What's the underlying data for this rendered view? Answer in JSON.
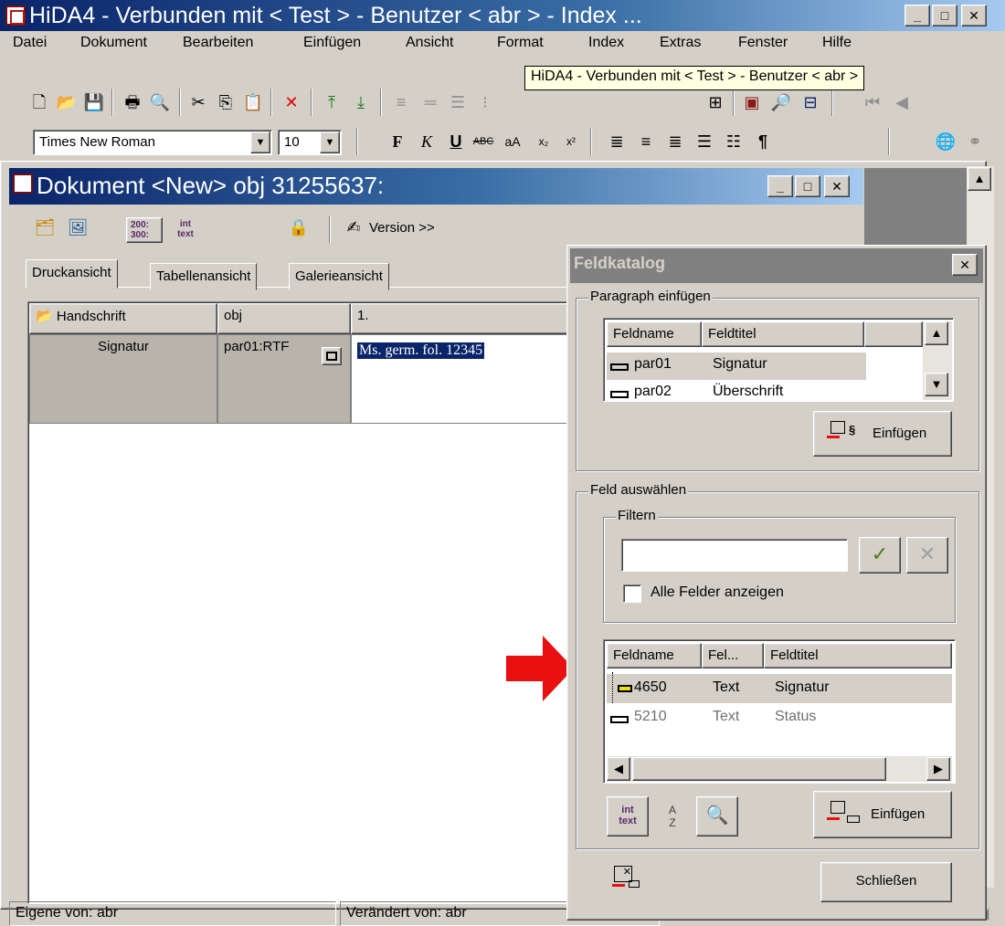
{
  "window": {
    "title": "HiDA4 - Verbunden mit < Test > - Benutzer < abr > - Index ..."
  },
  "menu": {
    "items": [
      "Datei",
      "Dokument",
      "Bearbeiten",
      "Einfügen",
      "Ansicht",
      "Format",
      "Index",
      "Extras",
      "Fenster",
      "Hilfe"
    ]
  },
  "tooltip": "HiDA4 - Verbunden mit < Test > - Benutzer < abr >",
  "format_toolbar": {
    "font": "Times New Roman",
    "size": "10"
  },
  "document": {
    "title": "Dokument <New> obj 31255637:",
    "toolbar": {
      "view_label_top": "200:",
      "view_label_bottom": "300:",
      "int_top": "int",
      "int_bottom": "text",
      "version": "Version >>"
    },
    "tabs": [
      "Druckansicht",
      "Tabellenansicht",
      "Galerieansicht"
    ],
    "table": {
      "headers": [
        "Handschrift",
        "obj",
        "1."
      ],
      "row": {
        "label": "Signatur",
        "field": "par01:RTF",
        "value": "Ms. germ. fol. 12345"
      }
    }
  },
  "status": {
    "owner": "Eigene von: abr",
    "modified": "Verändert von: abr"
  },
  "dialog": {
    "title": "Feldkatalog",
    "paragraph_group": "Paragraph einfügen",
    "paragraph_table": {
      "headers": [
        "Feldname",
        "Feldtitel"
      ],
      "rows": [
        {
          "name": "par01",
          "title": "Signatur"
        },
        {
          "name": "par02",
          "title": "Überschrift"
        }
      ]
    },
    "insert_paragraph": "Einfügen",
    "field_group": "Feld auswählen",
    "filter_group": "Filtern",
    "filter_value": "",
    "show_all": "Alle Felder anzeigen",
    "field_table": {
      "headers": [
        "Feldname",
        "Fel...",
        "Feldtitel"
      ],
      "rows": [
        {
          "name": "4650",
          "type": "Text",
          "title": "Signatur"
        },
        {
          "name": "5210",
          "type": "Text",
          "title": "Status"
        }
      ]
    },
    "int_top": "int",
    "int_bottom": "text",
    "sort_top": "A",
    "sort_bottom": "Z",
    "insert_field": "Einfügen",
    "close": "Schließen"
  },
  "colors": {
    "title_active": "#0a246a",
    "dialog_title_inactive": "#808080",
    "selection": "#0a246a",
    "arrow": "#e81010"
  }
}
